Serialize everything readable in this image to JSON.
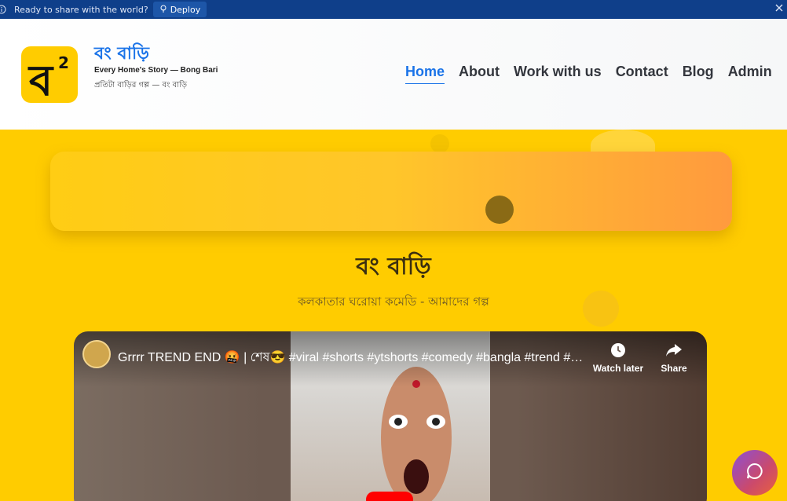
{
  "deploy_bar": {
    "message": "Ready to share with the world?",
    "button_label": "Deploy"
  },
  "brand": {
    "logo_letter": "ব",
    "logo_superscript": "2",
    "title": "বং বাড়ি",
    "tagline": "Every Home's Story — Bong Bari",
    "subtagline": "প্রতিটা বাড়ির গল্প — বং বাড়ি"
  },
  "nav": {
    "items": [
      {
        "label": "Home",
        "active": true
      },
      {
        "label": "About"
      },
      {
        "label": "Work with us"
      },
      {
        "label": "Contact"
      },
      {
        "label": "Blog"
      },
      {
        "label": "Admin"
      }
    ]
  },
  "hero": {
    "title": "বং বাড়ি",
    "subtitle": "কলকাতার ঘরোয়া কমেডি - আমাদের গল্প"
  },
  "video": {
    "title": "Grrrr TREND END 🤬 | শেষ😎 #viral #shorts #ytshorts #comedy #bangla #trend #bengali",
    "watch_later_label": "Watch later",
    "share_label": "Share"
  },
  "colors": {
    "page_bg": "#ffcc00",
    "accent": "#1a73e8",
    "deploy_bar": "#0f3f8a"
  },
  "icons": [
    "info-icon",
    "deploy-icon",
    "close-icon",
    "clock-icon",
    "share-icon",
    "chat-icon"
  ]
}
